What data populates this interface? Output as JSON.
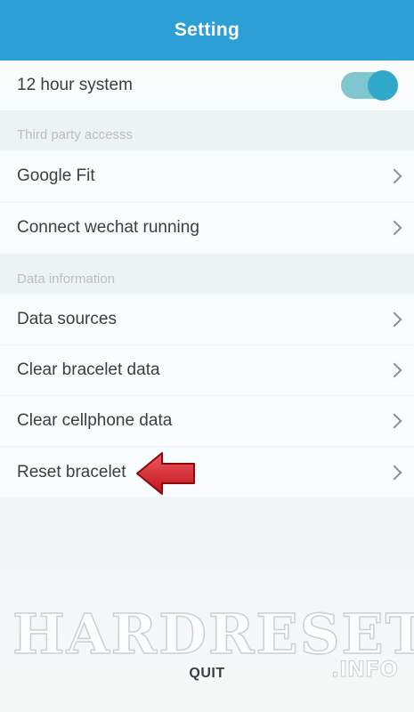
{
  "header": {
    "title": "Setting"
  },
  "rows": {
    "hour_system": {
      "label": "12 hour system",
      "toggle_on": true
    },
    "google_fit": {
      "label": "Google Fit"
    },
    "wechat": {
      "label": "Connect wechat running"
    },
    "data_sources": {
      "label": "Data sources"
    },
    "clear_bracelet": {
      "label": "Clear bracelet data"
    },
    "clear_cellphone": {
      "label": "Clear cellphone data"
    },
    "reset_bracelet": {
      "label": "Reset bracelet"
    }
  },
  "sections": {
    "third_party": "Third party accesss",
    "data_info": "Data information"
  },
  "footer": {
    "quit_label": "QUIT"
  },
  "watermark": {
    "main": "HARDRESET",
    "suffix": ".INFO"
  },
  "colors": {
    "header": "#2b9fd6",
    "toggle_track": "#7fc6cf",
    "toggle_knob": "#2fa9c7",
    "arrow": "#d3202a"
  },
  "icons": {
    "chevron": "chevron-right-icon",
    "pointer": "red-arrow-pointer-icon"
  }
}
